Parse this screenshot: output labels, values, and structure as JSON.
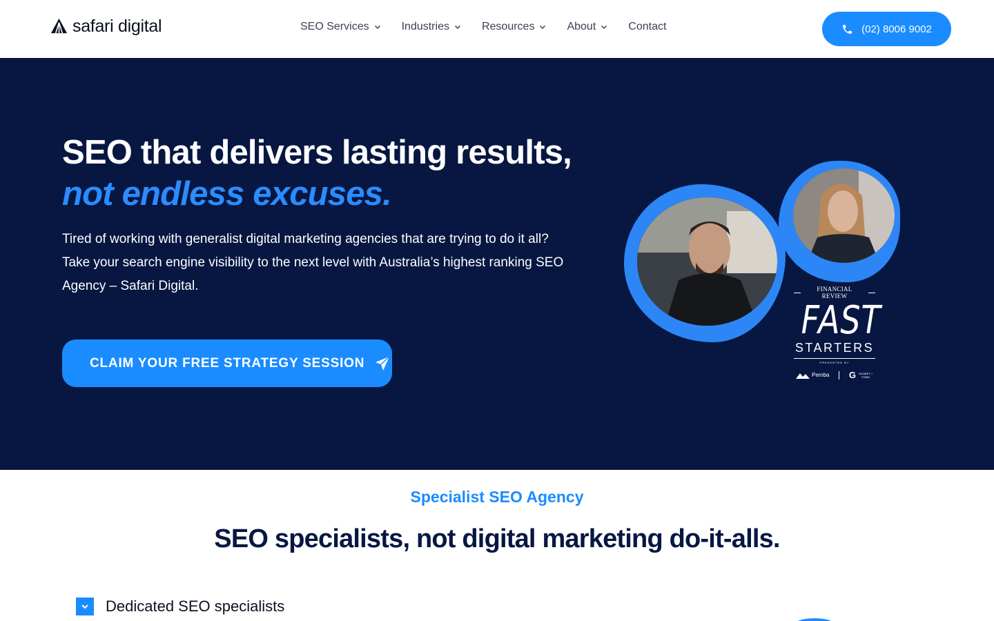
{
  "header": {
    "logo_text": "safari digital",
    "logo_icon": "leaf-logo-icon",
    "nav": [
      {
        "label": "SEO Services",
        "has_dropdown": true
      },
      {
        "label": "Industries",
        "has_dropdown": true
      },
      {
        "label": "Resources",
        "has_dropdown": true
      },
      {
        "label": "About",
        "has_dropdown": true
      },
      {
        "label": "Contact",
        "has_dropdown": false
      }
    ],
    "phone": "(02) 8006 9002"
  },
  "hero": {
    "title_line1": "SEO that delivers lasting results,",
    "title_line2": "not endless excuses.",
    "body": "Tired of working with generalist digital marketing agencies that are trying to do it all? Take your search engine visibility to the next level with Australia’s highest ranking SEO Agency – Safari Digital.",
    "cta_label": "CLAIM YOUR FREE STRATEGY SESSION",
    "badge": {
      "top": "FINANCIAL REVIEW",
      "main": "FAST",
      "sub": "STARTERS",
      "presented": "PRESENTED BY",
      "sponsor1": "Pemba",
      "sponsor2": "GILBERT + TOBIN"
    }
  },
  "section": {
    "eyebrow": "Specialist SEO Agency",
    "title": "SEO specialists, not digital marketing do-it-alls.",
    "features": [
      "Dedicated SEO specialists"
    ]
  },
  "colors": {
    "accent": "#1a8cff",
    "hero_bg": "#071742",
    "heading": "#071742"
  }
}
